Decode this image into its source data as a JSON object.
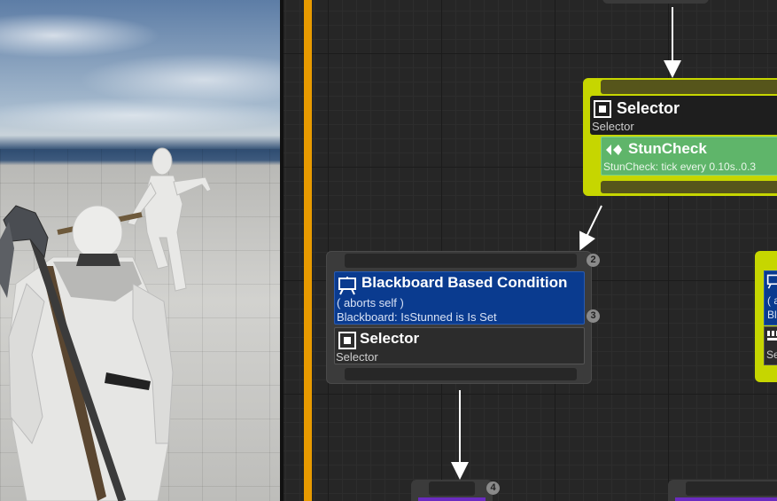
{
  "top_selector": {
    "title": "Selector",
    "subtitle": "Selector",
    "service": {
      "title": "StunCheck",
      "subtitle": "StunCheck: tick every 0.10s..0.3"
    }
  },
  "mid_node": {
    "badge_top": "2",
    "decorator": {
      "title": "Blackboard Based Condition",
      "line1": "( aborts self )",
      "line2": "Blackboard: IsStunned is Is Set",
      "badge": "3"
    },
    "selector": {
      "title": "Selector",
      "subtitle": "Selector"
    }
  },
  "right_node": {
    "line1": "( a",
    "line2": "Bl",
    "line3": "Se"
  },
  "bottom_node": {
    "badge": "4"
  },
  "colors": {
    "selector_highlight": "#c6d600",
    "decorator_blue": "#0a3b8f",
    "service_green": "#5fb56a",
    "graph_background": "#262626",
    "viewport_border": "#e89a00"
  },
  "icons": [
    "selector-icon",
    "service-icon",
    "decorator-icon"
  ]
}
